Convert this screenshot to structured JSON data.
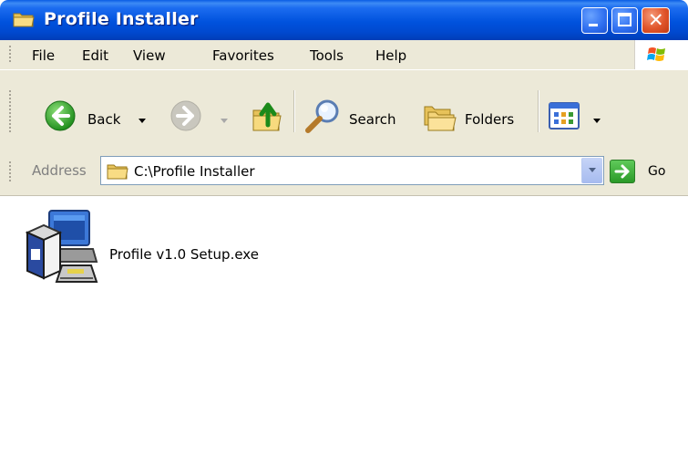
{
  "window": {
    "title": "Profile Installer"
  },
  "menu": {
    "items": [
      "File",
      "Edit",
      "View",
      "Favorites",
      "Tools",
      "Help"
    ]
  },
  "toolbar": {
    "back_label": "Back",
    "search_label": "Search",
    "folders_label": "Folders"
  },
  "address": {
    "label": "Address",
    "path": "C:\\Profile Installer",
    "go_label": "Go"
  },
  "files": [
    {
      "name": "Profile v1.0 Setup.exe",
      "icon": "setup-installer-icon"
    }
  ],
  "colors": {
    "titlebar": "#0052dd",
    "chrome": "#ece9d8",
    "close": "#e0542a",
    "go": "#3fae3a"
  }
}
